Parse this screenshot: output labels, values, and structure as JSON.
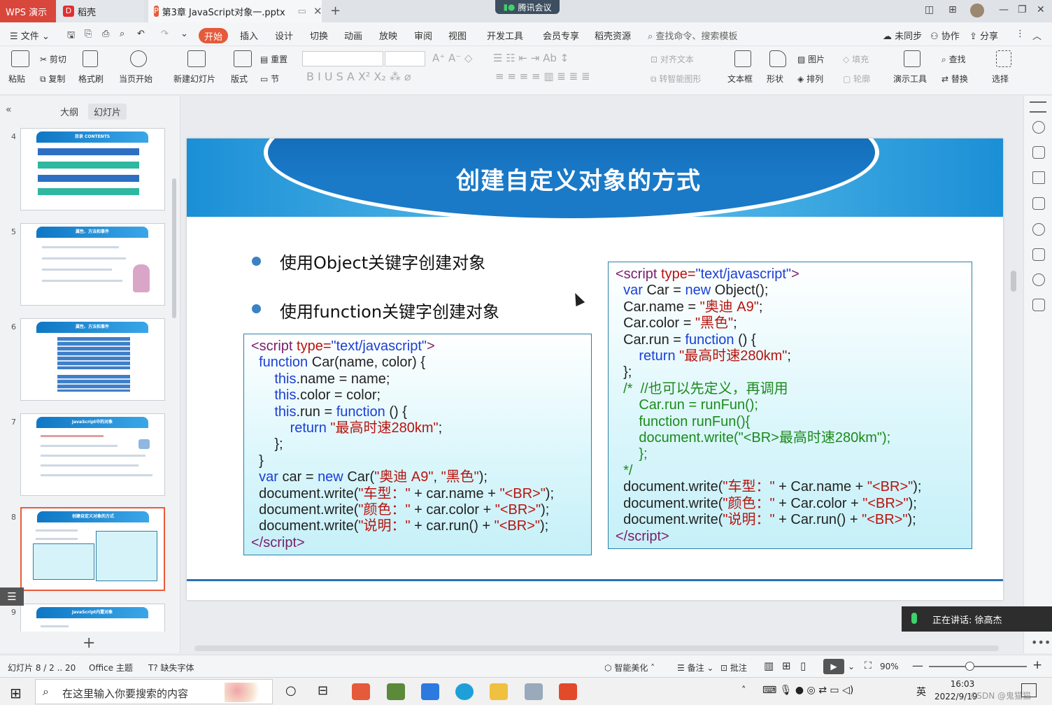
{
  "titlebar": {
    "wps_tab": "WPS 演示",
    "daoke_tab": "稻壳",
    "doc_tab": "第3章 JavaScript对象一.pptx",
    "meeting": "腾讯会议"
  },
  "menu": {
    "file": "文件",
    "items": [
      "开始",
      "插入",
      "设计",
      "切换",
      "动画",
      "放映",
      "审阅",
      "视图",
      "开发工具",
      "会员专享",
      "稻壳资源"
    ],
    "search": "查找命令、搜索模板",
    "sync": "未同步",
    "collab": "协作",
    "share": "分享"
  },
  "ribbon": {
    "paste": "粘贴",
    "cut": "剪切",
    "copy": "复制",
    "format_painter": "格式刷",
    "from_current": "当页开始",
    "new_slide": "新建幻灯片",
    "layout": "版式",
    "reset": "重置",
    "section": "节",
    "align_text": "对齐文本",
    "convert_smartart": "转智能图形",
    "textbox": "文本框",
    "shape": "形状",
    "picture": "图片",
    "arrange": "排列",
    "fill": "填充",
    "outline": "轮廓",
    "present_tools": "演示工具",
    "find": "查找",
    "replace": "替换",
    "select": "选择"
  },
  "leftpane": {
    "tab_outline": "大纲",
    "tab_slides": "幻灯片",
    "thumbs": [
      {
        "num": "4",
        "title": "目录 CONTENTS"
      },
      {
        "num": "5",
        "title": "属性、方法和事件"
      },
      {
        "num": "6",
        "title": "属性、方法和事件"
      },
      {
        "num": "7",
        "title": "JavaScript中的对象"
      },
      {
        "num": "8",
        "title": "创建自定义对象的方式"
      },
      {
        "num": "9",
        "title": "JavaScript内置对象"
      }
    ]
  },
  "slide": {
    "title": "创建自定义对象的方式",
    "bullet1": "使用Object关键字创建对象",
    "bullet2": "使用function关键字创建对象"
  },
  "status": {
    "slide_info": "幻灯片 8 / 2 .. 20",
    "theme": "Office 主题",
    "missing_font": "缺失字体",
    "beautify": "智能美化",
    "notes": "备注",
    "comment": "批注",
    "zoom": "90%"
  },
  "speaking": "正在讲话: 徐高杰",
  "taskbar": {
    "search_placeholder": "在这里输入你要搜索的内容",
    "ime": "英",
    "time": "16:03",
    "date": "2022/9/19",
    "watermark": "CSDN @鬼猫猫"
  },
  "colors": {
    "accent": "#e45a3a",
    "slide_blue": "#1b8fd6",
    "code_keyword": "#1a3fd4",
    "code_string": "#b8140f",
    "code_comment": "#1c8a1c"
  }
}
